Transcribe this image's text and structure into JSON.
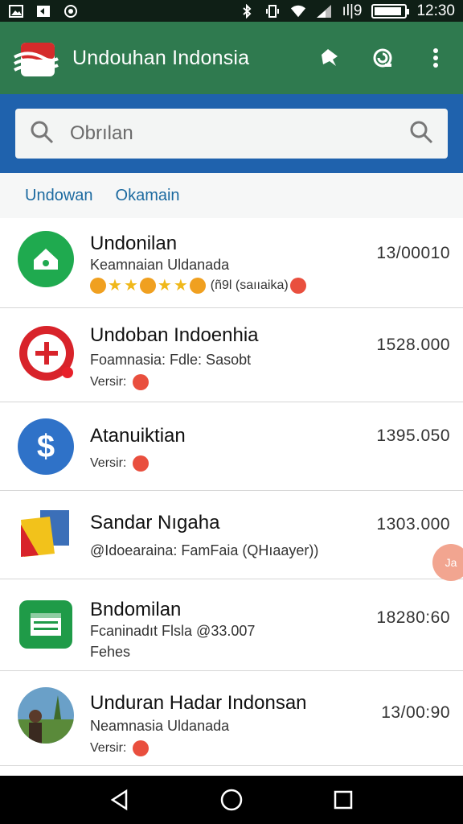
{
  "status_bar": {
    "time": "12:30",
    "signal_text": "ıl|9",
    "battery_level": 0.9,
    "icons": [
      "image-icon",
      "notification-icon",
      "whatsapp-icon",
      "bluetooth-icon",
      "vibrate-icon",
      "wifi-icon",
      "signal-icon",
      "battery-icon"
    ]
  },
  "app_bar": {
    "title": "Undouhan Indonsia",
    "actions": [
      "pin-icon",
      "sync-icon",
      "more-vert-icon"
    ]
  },
  "search": {
    "placeholder": "Obrılan"
  },
  "tabs": [
    {
      "label": "Undowan"
    },
    {
      "label": "Okamain"
    }
  ],
  "items": [
    {
      "title": "Undonilan",
      "subtitle": "Keamnaian Uldanada",
      "extra": "(ñ9l (saııaika)",
      "price": "13/00010",
      "icon": "home-icon",
      "icon_color": "#1faa4f"
    },
    {
      "title": "Undoban Indoenhia",
      "subtitle": "Foamnasia: Fdle: Sasobt",
      "version": "Versir:",
      "price": "1528.000",
      "icon": "plus-icon",
      "icon_color": "#d8232a"
    },
    {
      "title": "Atanuiktian",
      "version": "Versir:",
      "price": "1395.050",
      "icon": "dollar-icon",
      "icon_color": "#2f72c8"
    },
    {
      "title": "Sandar Nıgaha",
      "subtitle": "@Idoearaina: FamFaia (QHıaayer))",
      "price": "1303.000",
      "icon": "folder-app-icon",
      "icon_color": "#f2c21b"
    },
    {
      "title": "Bndomilan",
      "subtitle": "Fcaninadıt Flsla @33.007",
      "version": "Fehes",
      "price": "18280:60",
      "icon": "calendar-icon",
      "icon_color": "#1f9b48"
    },
    {
      "title": "Unduran Hadar Indonsan",
      "subtitle": "Neamnasia Uldanada",
      "version": "Versir:",
      "price": "13/00:90",
      "icon": "photo-avatar-icon",
      "icon_color": "#6aa0c8"
    }
  ],
  "floating_badge": "Ja",
  "nav_bar": {
    "buttons": [
      "back-icon",
      "home-circle-icon",
      "recents-icon"
    ]
  }
}
